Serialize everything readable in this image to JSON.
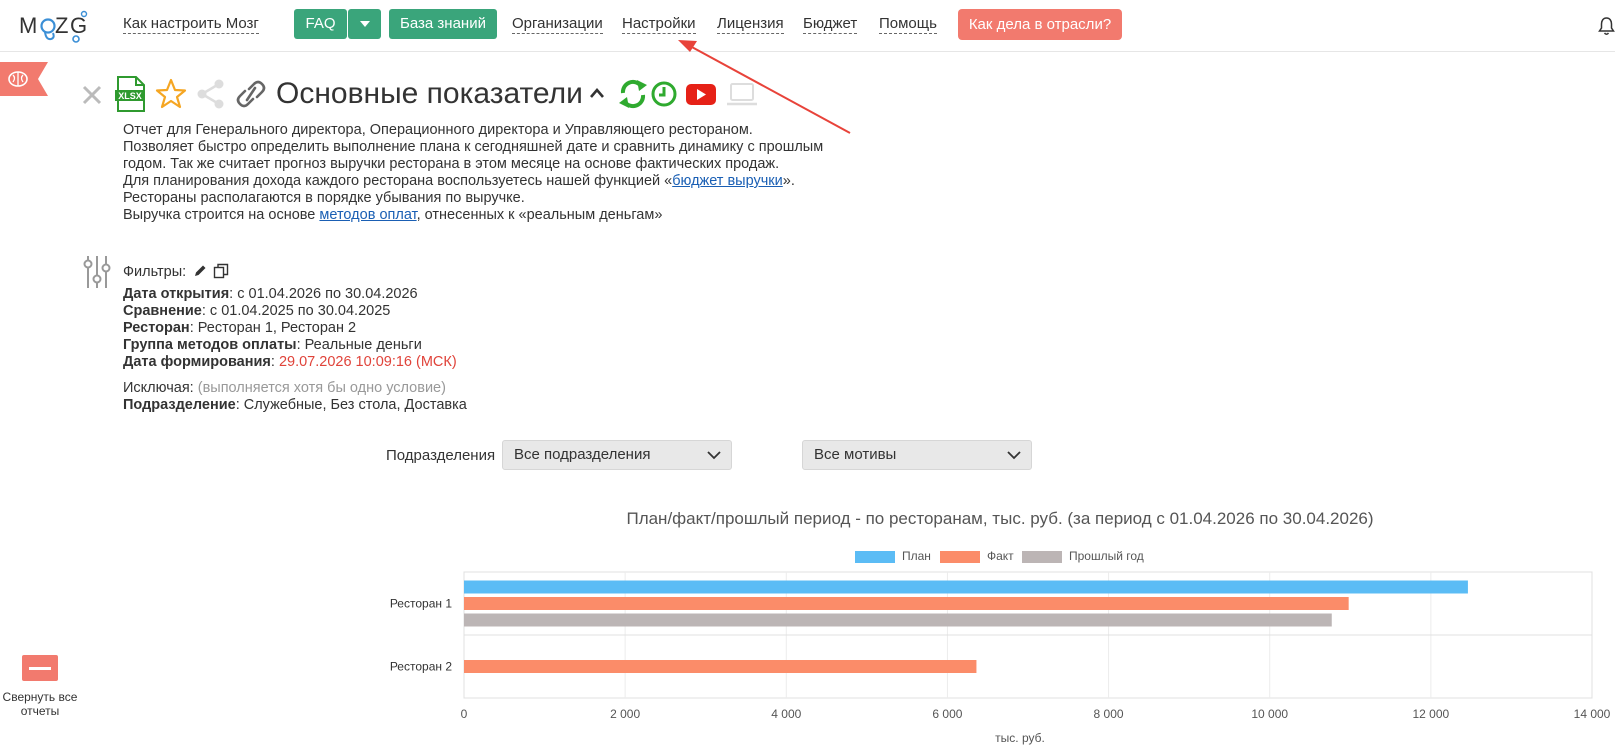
{
  "header": {
    "logo_text": "MOZG",
    "nav": {
      "how_to": "Как настроить Мозг",
      "faq": "FAQ",
      "knowledge_base": "База знаний",
      "organizations": "Организации",
      "settings": "Настройки",
      "license": "Лицензия",
      "budget": "Бюджет",
      "help": "Помощь",
      "industry": "Как дела в отрасли?"
    },
    "accent_color": "#3aa57b",
    "highlight_color": "#f27a6e"
  },
  "report": {
    "title": "Основные показатели",
    "toolbar_icons": [
      "close-icon",
      "xlsx-icon",
      "star-icon",
      "share-icon",
      "link-icon",
      "refresh-icon",
      "clock-icon",
      "youtube-icon",
      "laptop-icon"
    ],
    "xlsx_badge": "XLSX",
    "description": {
      "line1": "Отчет для Генерального директора, Операционного директора и Управляющего рестораном.",
      "line2": "Позволяет быстро определить выполнение плана к сегодняшней дате и сравнить динамику с прошлым годом. Так же считает прогноз выручки ресторана в этом месяце на основе фактических продаж.",
      "line3_before": "Для планирования дохода каждого ресторана воспользуетесь нашей функцией «",
      "line3_link": "бюджет выручки",
      "line3_after": "».",
      "line4": "Рестораны располагаются в порядке убывания по выручке.",
      "line5_before": "Выручка строится на основе ",
      "line5_link": "методов оплат",
      "line5_after": ", отнесенных к «реальным деньгам»"
    },
    "filters": {
      "heading": "Фильтры:",
      "open_date_label": "Дата открытия",
      "open_date_value": ": с 01.04.2026 по 30.04.2026",
      "compare_label": "Сравнение",
      "compare_value": ": с 01.04.2025 по 30.04.2025",
      "restaurant_label": "Ресторан",
      "restaurant_value": ": Ресторан 1, Ресторан 2",
      "payment_group_label": "Группа методов оплаты",
      "payment_group_value": ": Реальные деньги",
      "generated_label": "Дата формирования",
      "generated_colon": ": ",
      "generated_value": "29.07.2026 10:09:16 (МСК)",
      "excluding_label": "Исключая: ",
      "excluding_note": "(выполняется хотя бы одно условие)",
      "division_label": "Подразделение",
      "division_value": ": Служебные, Без стола, Доставка"
    },
    "selectors": {
      "division_label": "Подразделения",
      "division_value": "Все подразделения",
      "motive_value": "Все мотивы"
    },
    "collapse_label": "Свернуть все отчеты"
  },
  "chart_data": {
    "type": "bar",
    "orientation": "horizontal",
    "title": "План/факт/прошлый период - по ресторанам, тыс. руб. (за период с 01.04.2026 по 30.04.2026)",
    "xlabel": "тыс. руб.",
    "ylabel": "",
    "categories": [
      "Ресторан 1",
      "Ресторан 2"
    ],
    "series": [
      {
        "name": "План",
        "color": "#5bbcf5",
        "values": [
          12460,
          0
        ]
      },
      {
        "name": "Факт",
        "color": "#fb8c69",
        "values": [
          10980,
          6360
        ]
      },
      {
        "name": "Прошлый год",
        "color": "#bcb5b5",
        "values": [
          10770,
          0
        ]
      }
    ],
    "xlim": [
      0,
      14000
    ],
    "ticks": [
      "0",
      "2 000",
      "4 000",
      "6 000",
      "8 000",
      "10 000",
      "12 000",
      "14 000"
    ],
    "grid": true,
    "legend_position": "top"
  }
}
